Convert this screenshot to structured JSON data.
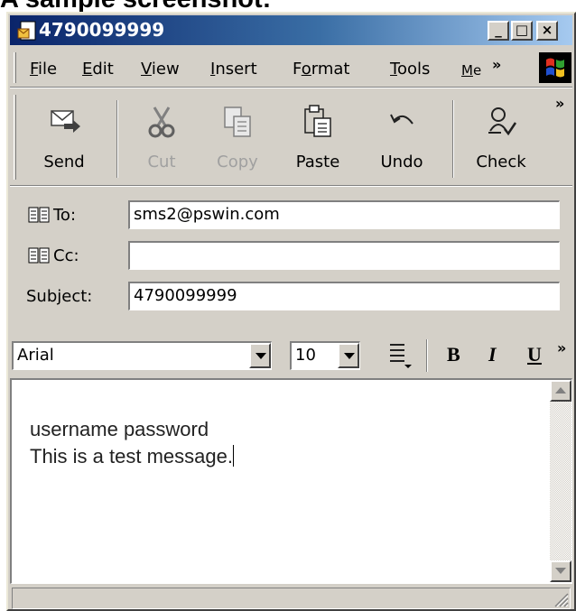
{
  "caption": "A sample screenshot:",
  "window": {
    "title": "4790099999"
  },
  "title_buttons": {
    "minimize": "_",
    "maximize": "□",
    "close": "×"
  },
  "menubar": {
    "items": [
      {
        "label": "File",
        "key": "F"
      },
      {
        "label": "Edit",
        "key": "E"
      },
      {
        "label": "View",
        "key": "V"
      },
      {
        "label": "Insert",
        "key": "I"
      },
      {
        "label": "Format",
        "key": "o"
      },
      {
        "label": "Tools",
        "key": "T"
      },
      {
        "label": "Me",
        "key": "M"
      }
    ],
    "overflow": "»"
  },
  "toolbar": {
    "send": "Send",
    "cut": "Cut",
    "copy": "Copy",
    "paste": "Paste",
    "undo": "Undo",
    "check": "Check",
    "overflow": "»"
  },
  "header": {
    "to_label": "To:",
    "to_value": "sms2@pswin.com",
    "cc_label": "Cc:",
    "cc_value": "",
    "subject_label": "Subject:",
    "subject_value": "4790099999"
  },
  "format": {
    "font": "Arial",
    "size": "10",
    "bold": "B",
    "italic": "I",
    "underline": "U",
    "overflow": "»"
  },
  "message": {
    "lines": [
      "username password",
      "This is a test message."
    ]
  },
  "colors": {
    "title_gradient_start": "#0a246a",
    "title_gradient_end": "#a6caf0",
    "chrome": "#d4d0c8"
  }
}
